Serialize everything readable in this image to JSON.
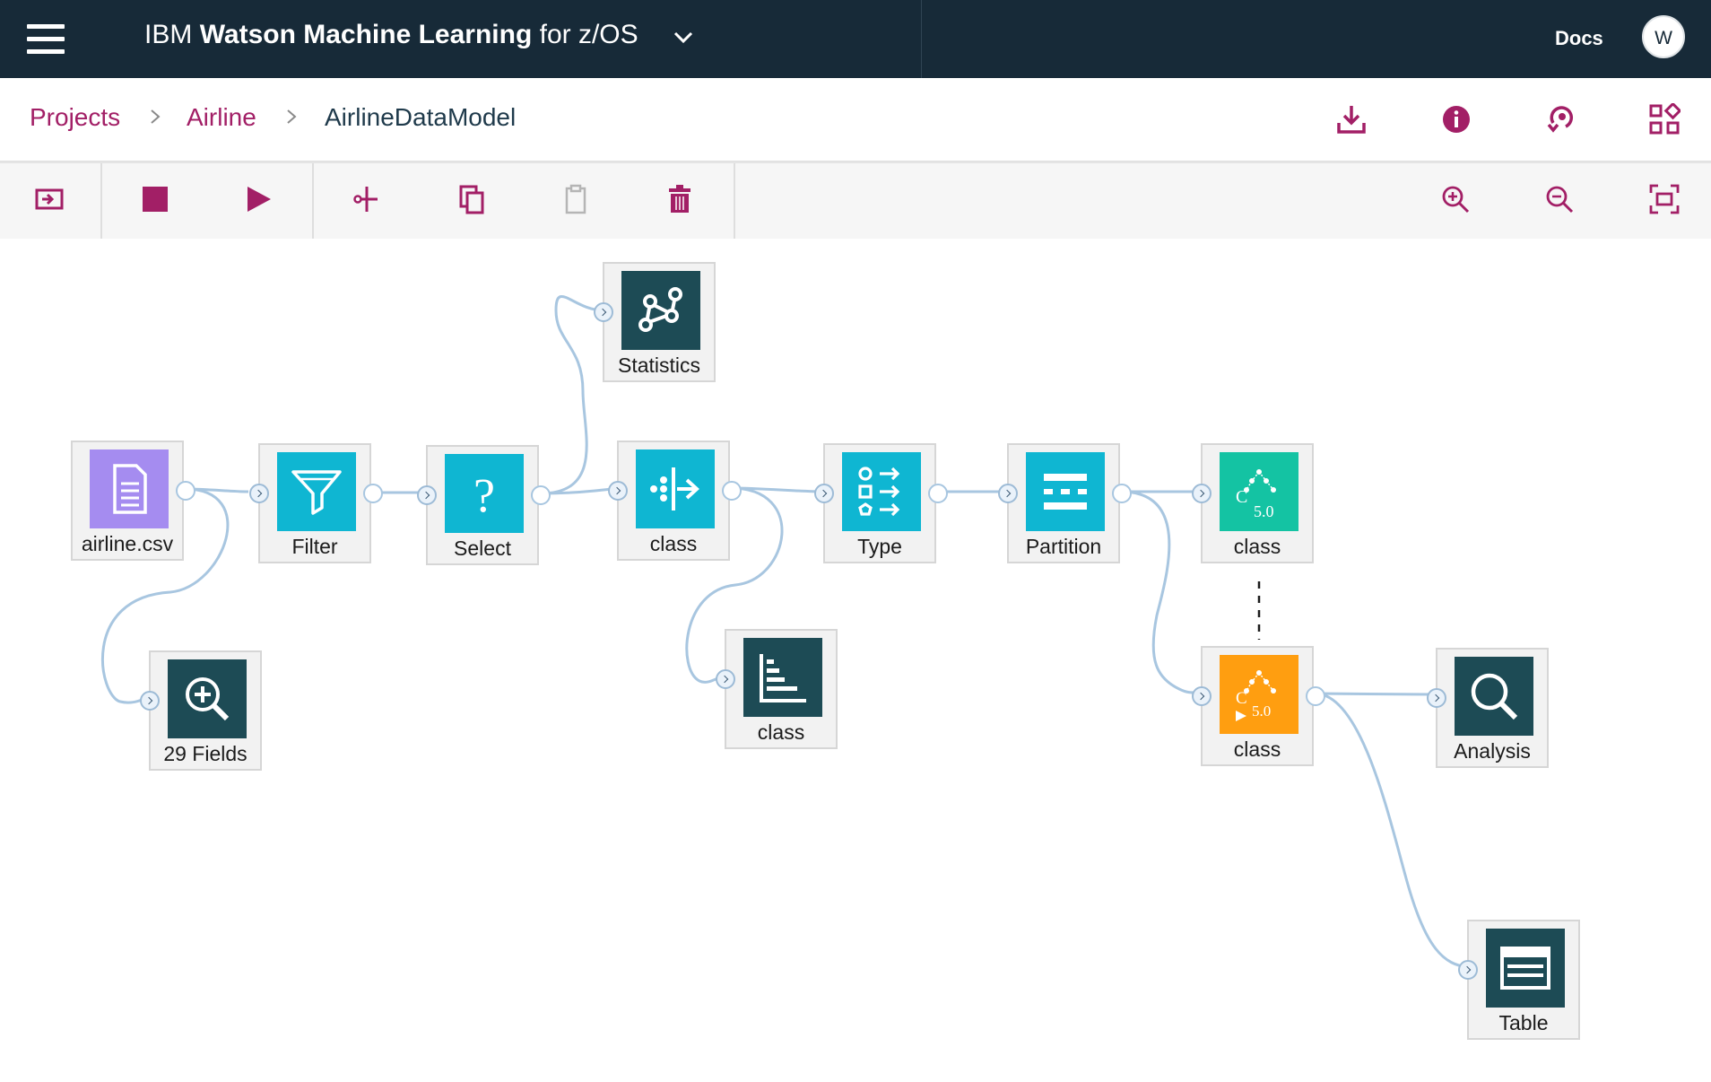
{
  "header": {
    "brand_prefix": "IBM",
    "product_name": "Watson Machine Learning",
    "product_suffix": "for z/OS",
    "docs_label": "Docs",
    "avatar_initial": "W"
  },
  "breadcrumb": {
    "items": [
      {
        "label": "Projects"
      },
      {
        "label": "Airline"
      },
      {
        "label": "AirlineDataModel"
      }
    ]
  },
  "breadcrumb_actions": [
    "download-icon",
    "info-icon",
    "deploy-icon",
    "apps-grid-icon"
  ],
  "toolbar": {
    "items": [
      "open-palette-icon",
      "stop-icon",
      "run-icon",
      "cut-icon",
      "copy-icon",
      "paste-icon",
      "delete-icon",
      "zoom-in-icon",
      "zoom-out-icon",
      "fit-to-screen-icon"
    ]
  },
  "colors": {
    "header_bg": "#172a38",
    "accent": "#a21f66",
    "node_dark": "#1d4b55",
    "node_cyan": "#0fb6d2",
    "node_purple": "#a58cf0",
    "node_green": "#14c3a3",
    "node_orange": "#ff9e10",
    "link": "#a8c6e0"
  },
  "flow": {
    "nodes": [
      {
        "id": "airline_csv",
        "label": "airline.csv",
        "icon": "document-icon"
      },
      {
        "id": "filter",
        "label": "Filter",
        "icon": "filter-icon"
      },
      {
        "id": "select",
        "label": "Select",
        "icon": "question-icon"
      },
      {
        "id": "statistics",
        "label": "Statistics",
        "icon": "graph-icon"
      },
      {
        "id": "class_split",
        "label": "class",
        "icon": "distribution-icon"
      },
      {
        "id": "type",
        "label": "Type",
        "icon": "type-icon"
      },
      {
        "id": "partition",
        "label": "Partition",
        "icon": "partition-icon"
      },
      {
        "id": "class_model",
        "label": "class",
        "icon": "c50-model-icon",
        "badge": "5.0",
        "letter": "C"
      },
      {
        "id": "fields",
        "label": "29 Fields",
        "icon": "zoom-icon"
      },
      {
        "id": "class_chart",
        "label": "class",
        "icon": "bar-chart-icon"
      },
      {
        "id": "class_nugget",
        "label": "class",
        "icon": "c50-nugget-icon",
        "badge": "5.0",
        "letter": "C"
      },
      {
        "id": "analysis",
        "label": "Analysis",
        "icon": "magnifier-icon"
      },
      {
        "id": "table",
        "label": "Table",
        "icon": "table-icon"
      }
    ]
  }
}
